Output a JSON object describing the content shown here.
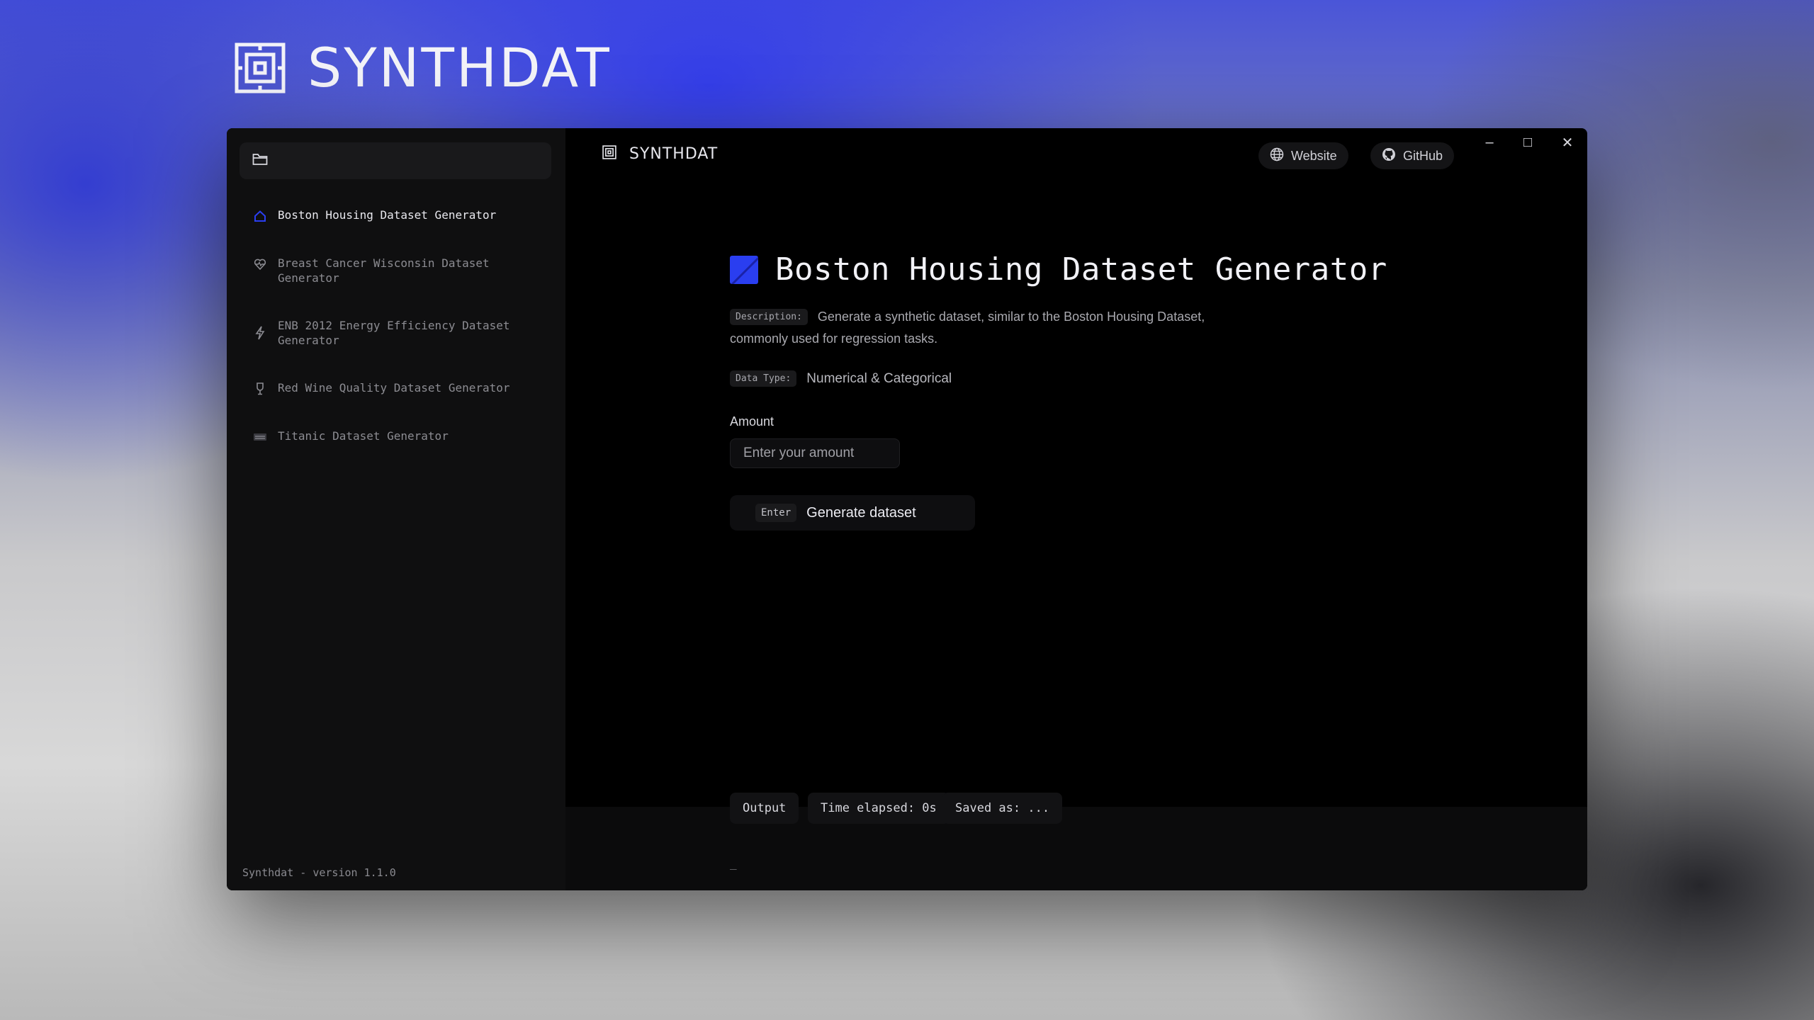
{
  "brand": {
    "name": "SYNTHDAT"
  },
  "window": {
    "title": "SYNTHDAT",
    "controls": {
      "minimize": "–",
      "maximize": "□",
      "close": "✕"
    },
    "links": [
      {
        "label": "Website",
        "icon": "globe-icon"
      },
      {
        "label": "GitHub",
        "icon": "github-icon"
      }
    ]
  },
  "sidebar": {
    "items": [
      {
        "label": "Boston Housing Dataset Generator",
        "icon": "house-icon",
        "active": true
      },
      {
        "label": "Breast Cancer Wisconsin Dataset Generator",
        "icon": "heart-pulse-icon"
      },
      {
        "label": "ENB 2012 Energy Efficiency Dataset Generator",
        "icon": "lightning-icon"
      },
      {
        "label": "Red Wine Quality Dataset Generator",
        "icon": "wine-glass-icon"
      },
      {
        "label": "Titanic Dataset Generator",
        "icon": "ship-icon"
      }
    ],
    "version": "Synthdat - version 1.1.0"
  },
  "main": {
    "title": "Boston Housing Dataset Generator",
    "description_tag": "Description:",
    "description_line1": "Generate a synthetic dataset, similar to the Boston Housing Dataset,",
    "description_line2": "commonly used for regression tasks.",
    "data_type_tag": "Data Type:",
    "data_type": "Numerical & Categorical",
    "amount_label": "Amount",
    "amount_placeholder": "Enter your amount",
    "generate_key": "Enter",
    "generate_label": "Generate dataset"
  },
  "output": {
    "label": "Output",
    "time_elapsed": "Time elapsed: 0s",
    "saved_as": "Saved as: ...",
    "cursor": "_"
  },
  "colors": {
    "accent": "#2a3ef0",
    "window_bg": "#000000",
    "sidebar_bg": "#0f0f10"
  }
}
